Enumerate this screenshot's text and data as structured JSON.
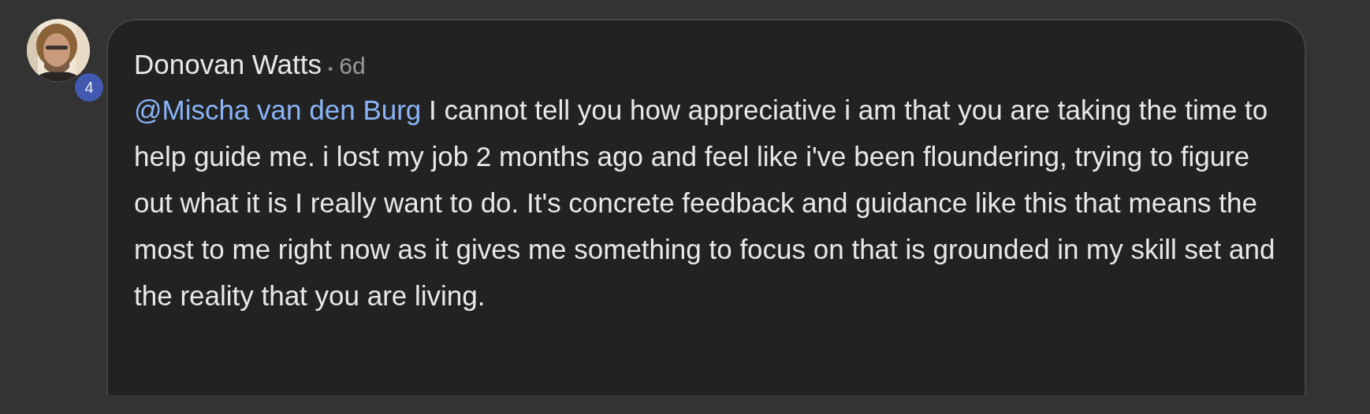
{
  "comment": {
    "avatar": {
      "kind": "picture",
      "badge": "4"
    },
    "author": "Donovan Watts",
    "separator": "•",
    "age": "6d",
    "mention": "@Mischa van den Burg",
    "text": "I cannot tell you how appreciative i am that you are taking the time to help guide me. i lost my job 2 months ago and feel like i've been floundering, trying to figure out what it is I really want to do. It's concrete feedback and guidance like this that means the most to me right now as it gives me something to focus on that is grounded in my skill set and the reality that you are living."
  }
}
